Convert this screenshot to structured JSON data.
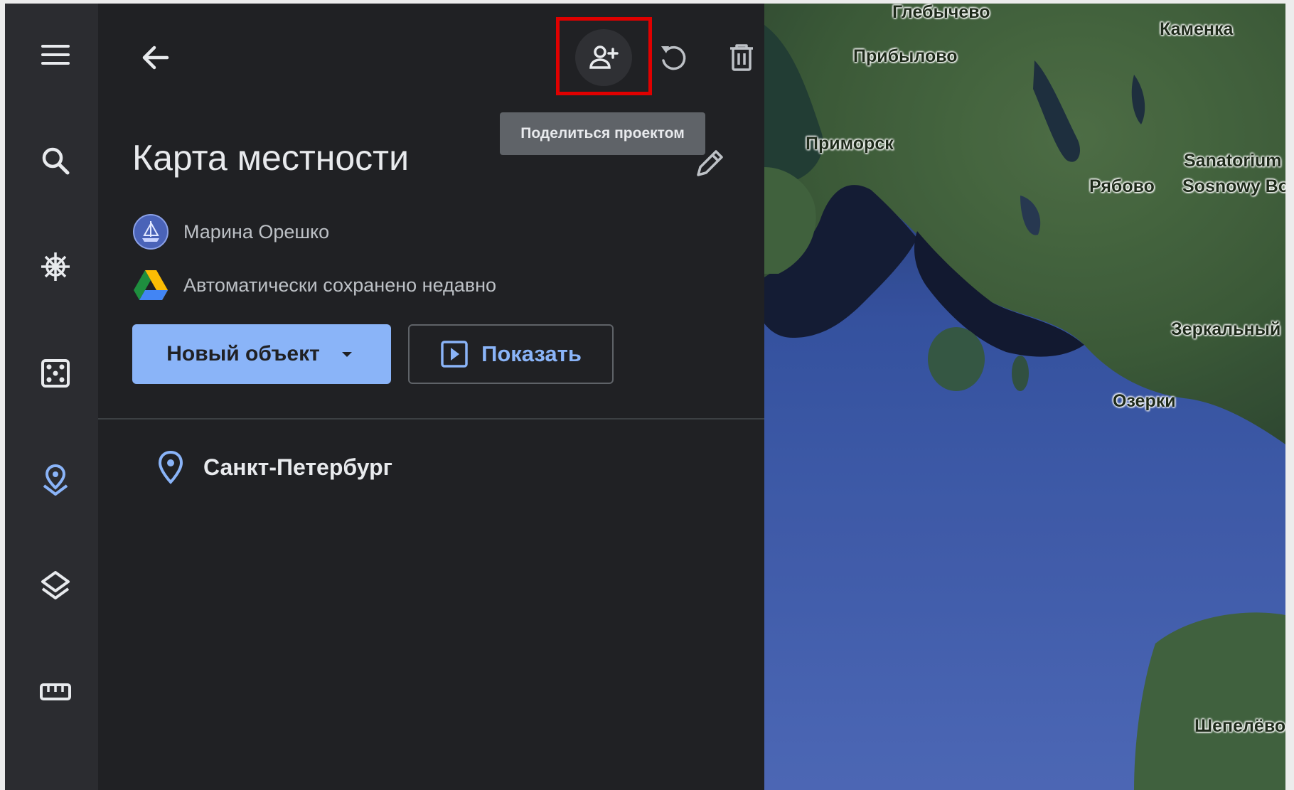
{
  "toolbar": {
    "share_tooltip": "Поделиться проектом"
  },
  "project": {
    "title": "Карта местности",
    "owner": "Марина Орешко",
    "save_status": "Автоматически сохранено недавно"
  },
  "actions": {
    "new_object_label": "Новый объект",
    "show_label": "Показать"
  },
  "items": [
    {
      "label": "Санкт-Петербург",
      "icon": "place-pin-icon"
    }
  ],
  "map_labels": [
    "Глебычево",
    "Каменка",
    "Прибылово",
    "Приморск",
    "Sanatorium",
    "Рябово",
    "Sosnowy Bo",
    "Зеркальный",
    "Озерки",
    "Шепелёво"
  ],
  "rail_icons": [
    "menu-icon",
    "search-icon",
    "voyager-icon",
    "dice-icon",
    "projects-icon",
    "layers-icon",
    "ruler-icon"
  ],
  "colors": {
    "accent": "#8ab4f8",
    "panel_bg": "#202124",
    "rail_bg": "#2b2c30",
    "highlight": "#e00000"
  }
}
